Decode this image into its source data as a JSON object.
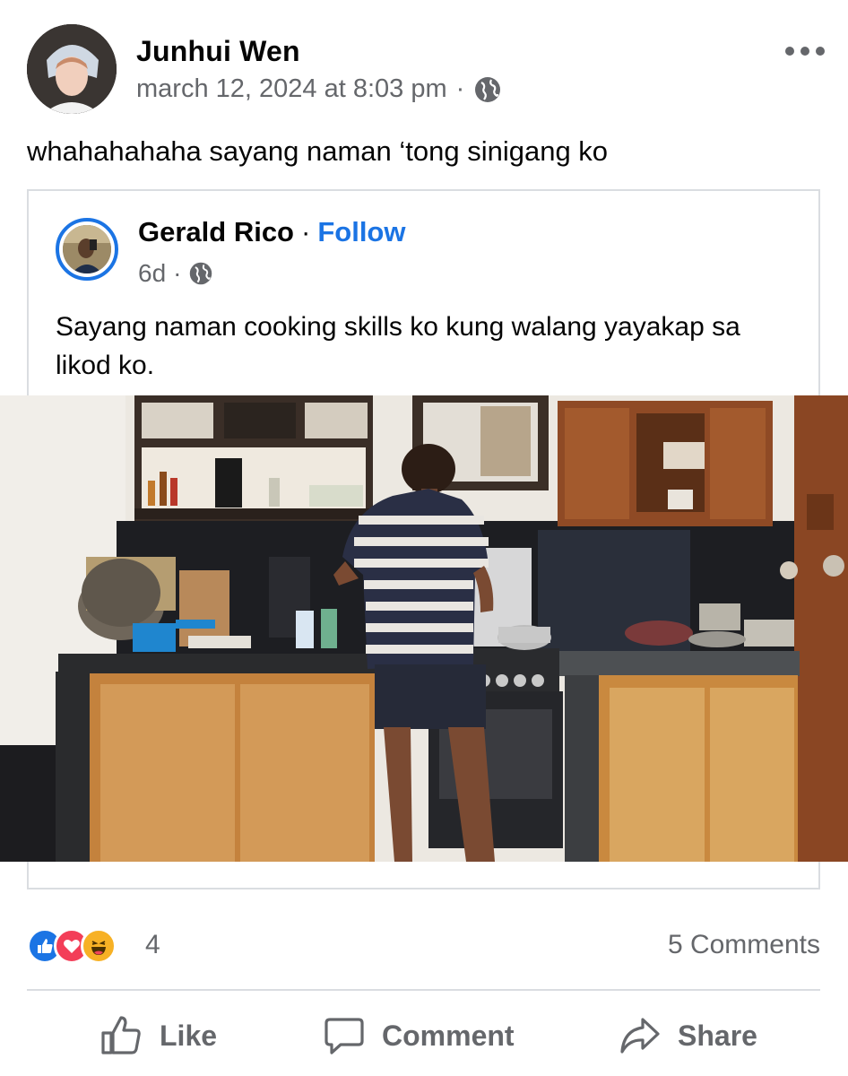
{
  "post": {
    "author": "Junhui Wen",
    "timestamp": "march 12, 2024 at 8:03 pm",
    "separator": "·",
    "privacy_icon": "globe-icon",
    "text": "whahahahaha sayang naman ‘tong sinigang ko"
  },
  "shared_post": {
    "author": "Gerald Rico",
    "separator": "·",
    "follow_label": "Follow",
    "age": "6d",
    "privacy_icon": "globe-icon",
    "text": "Sayang naman cooking skills ko kung walang yayakap sa likod ko."
  },
  "reactions": {
    "types": [
      "like",
      "love",
      "haha"
    ],
    "count": "4",
    "comments": "5 Comments"
  },
  "actions": {
    "like": "Like",
    "comment": "Comment",
    "share": "Share"
  },
  "colors": {
    "accent": "#1b74e4",
    "secondary_text": "#65676b",
    "love": "#f33e58",
    "haha": "#f7b125"
  }
}
